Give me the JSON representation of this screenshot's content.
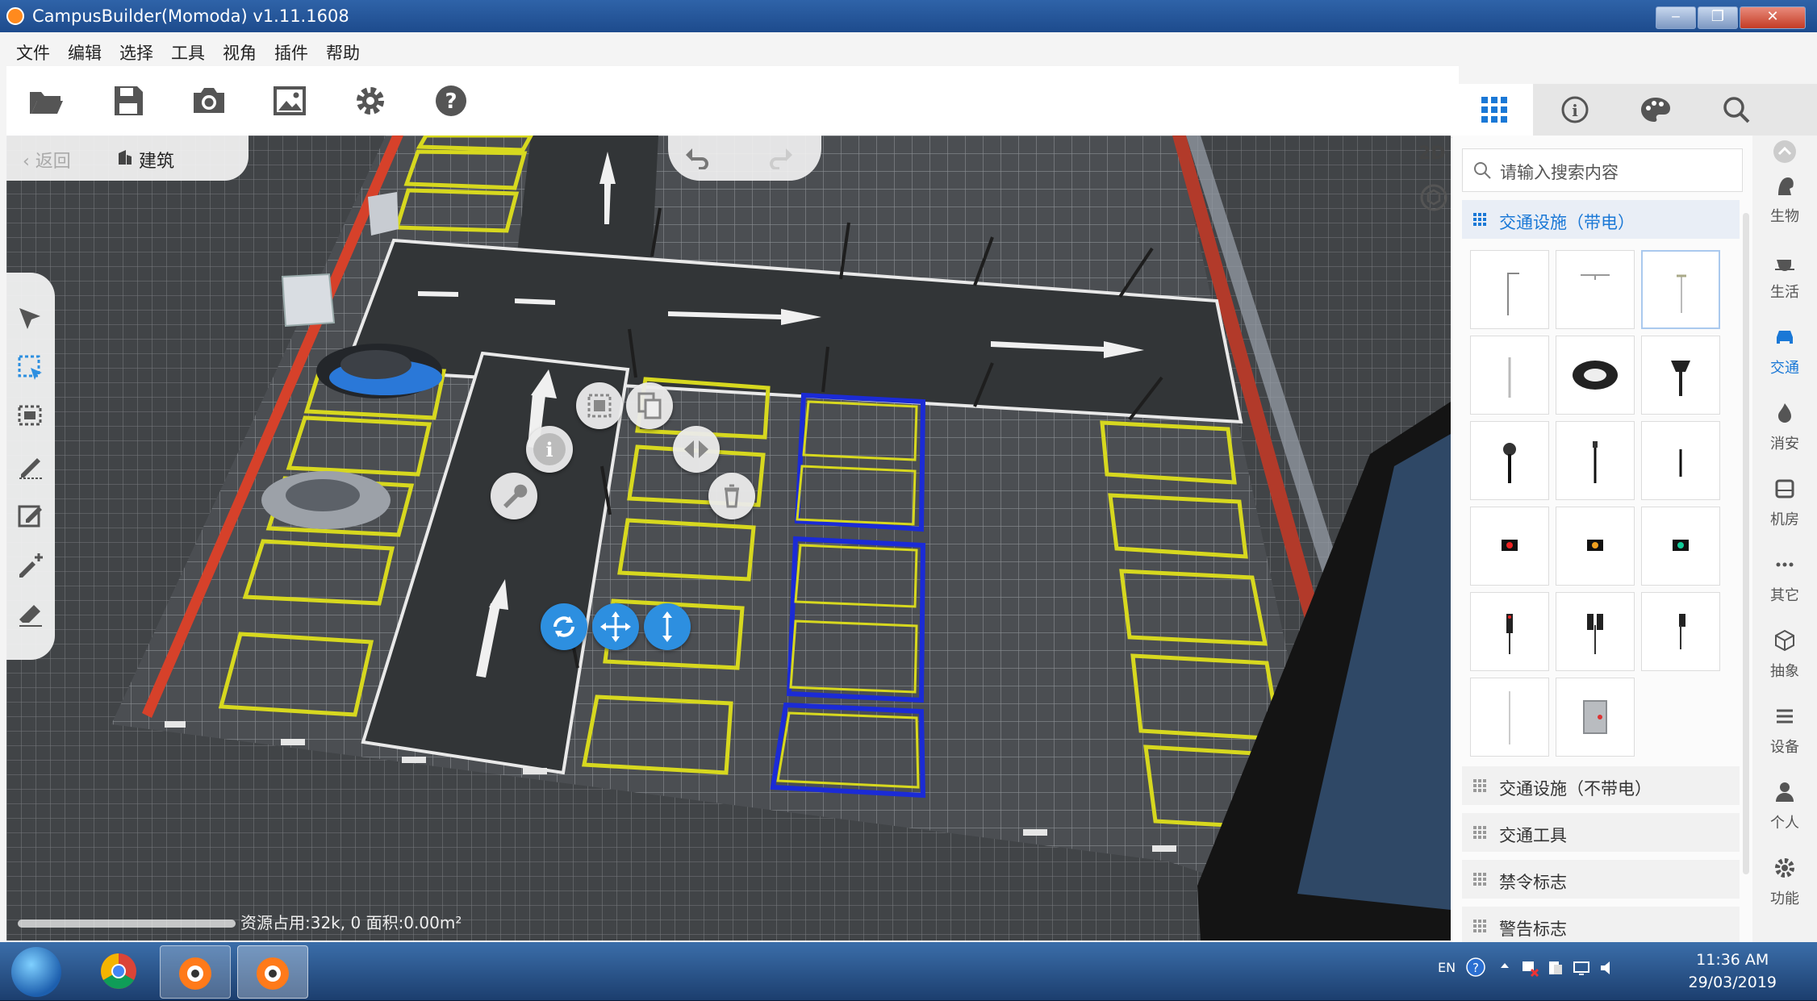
{
  "window": {
    "title": "CampusBuilder(Momoda) v1.11.1608",
    "min": "‒",
    "max": "❐",
    "close": "✕"
  },
  "menu": [
    "文件",
    "编辑",
    "选择",
    "工具",
    "视角",
    "插件",
    "帮助"
  ],
  "toolbar": [
    "folder-open",
    "save",
    "camera",
    "image",
    "settings",
    "help"
  ],
  "viewport": {
    "back_label": "返回",
    "breadcrumb": "建筑",
    "view_mode": "2D",
    "status": "资源占用:32k, 0   面积:0.00m²"
  },
  "panel": {
    "search_placeholder": "请输入搜索内容",
    "categories": [
      "交通设施（带电）",
      "交通设施（不带电）",
      "交通工具",
      "禁令标志",
      "警告标志"
    ],
    "side_nav": [
      "生物",
      "生活",
      "交通",
      "消安",
      "机房",
      "其它",
      "抽象",
      "设备",
      "个人",
      "功能"
    ]
  },
  "taskbar": {
    "lang": "EN",
    "time": "11:36 AM",
    "date": "29/03/2019"
  },
  "colors": {
    "accent": "#1a78d6",
    "titlebar": "#1d4b8d",
    "parking_line": "#d7d81f",
    "selected_line": "#1b2bd6"
  }
}
